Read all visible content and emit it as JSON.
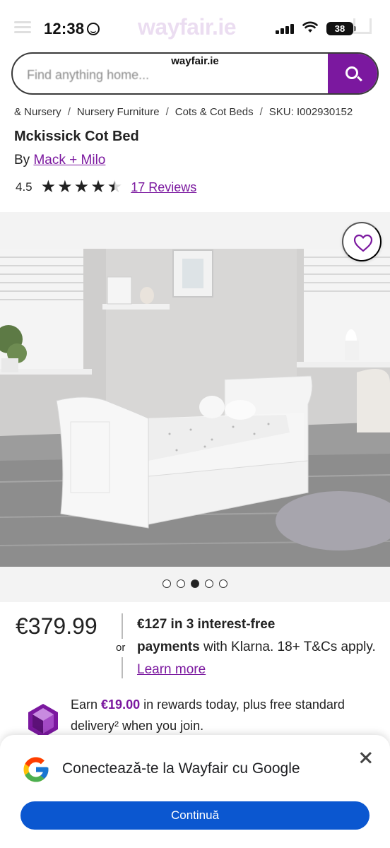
{
  "status_bar": {
    "time": "12:38",
    "battery": "38"
  },
  "browser": {
    "domain": "wayfair.ie"
  },
  "header": {
    "logo": "wayfair.ie"
  },
  "search": {
    "placeholder": "Find anything home..."
  },
  "breadcrumb": [
    "& Nursery",
    "Nursery Furniture",
    "Cots & Cot Beds",
    "SKU: I002930152"
  ],
  "breadcrumb_sep": "/",
  "product": {
    "title": "Mckissick Cot Bed",
    "by_prefix": "By",
    "brand": "Mack + Milo",
    "rating": "4.5",
    "rating_value": 4.5,
    "reviews_label": "17 Reviews"
  },
  "gallery": {
    "active_index": 3,
    "total": 5
  },
  "pricing": {
    "price": "€379.99",
    "or_label": "or",
    "klarna_bold_1": "€127 in 3 interest-free",
    "klarna_bold_2": "payments",
    "klarna_rest": " with Klarna. 18+ T&Cs apply. ",
    "learn_more": "Learn more"
  },
  "rewards": {
    "prefix": "Earn ",
    "amount": "€19.00",
    "suffix": " in rewards today, plus free standard delivery² when you join."
  },
  "google_prompt": {
    "title": "Conectează-te la Wayfair cu Google",
    "continue_label": "Continuă"
  },
  "colors": {
    "brand": "#7b189f",
    "google_blue": "#0b57d0"
  }
}
